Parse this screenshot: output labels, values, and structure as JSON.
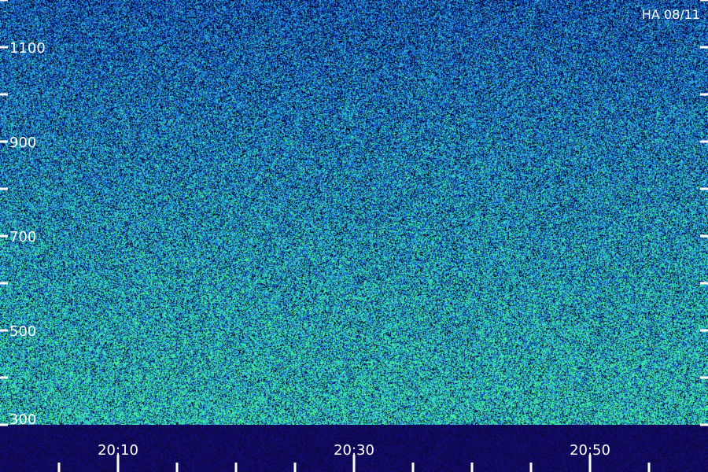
{
  "chart_data": {
    "type": "heatmap",
    "title": "",
    "tag": "HA 08/11",
    "xlabel": "",
    "ylabel": "",
    "x_tick_labels": [
      "20:10",
      "20:30",
      "20:50"
    ],
    "x_tick_values": [
      10,
      30,
      50
    ],
    "x_minor_tick_step": 5,
    "xlim": [
      0,
      60
    ],
    "y_tick_labels": [
      "1100",
      "900",
      "700",
      "500",
      "300"
    ],
    "y_tick_values": [
      1100,
      900,
      700,
      500,
      300
    ],
    "y_minor_tick_step": 100,
    "ylim": [
      300,
      1200
    ],
    "grid": false,
    "legend": "none",
    "colors": {
      "background": "#000000",
      "low": "#0a1a8c",
      "mid": "#2a7fd8",
      "high": "#2fe0a0",
      "band": "#0a0a55",
      "text": "#ffffff"
    }
  }
}
